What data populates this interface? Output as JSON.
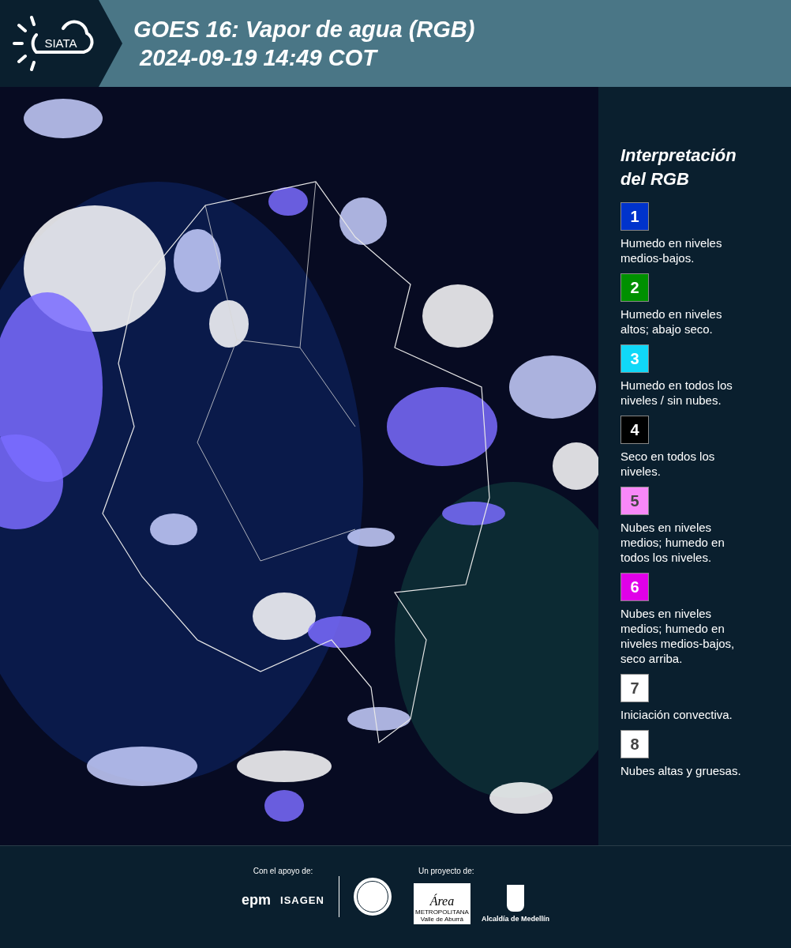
{
  "header": {
    "logo": "SIATA",
    "title_lines": [
      "GOES 16: Vapor de agua (RGB)",
      " 2024-09-19 14:49 COT"
    ]
  },
  "legend": {
    "title_lines": [
      "Interpretación",
      "del RGB"
    ],
    "items": [
      {
        "number": "1",
        "color": "#0033cc",
        "text": "Humedo en niveles medios-bajos."
      },
      {
        "number": "2",
        "color": "#009000",
        "text": "Humedo en niveles altos; abajo seco."
      },
      {
        "number": "3",
        "color": "#10d8f8",
        "text": "Humedo en todos los niveles / sin nubes."
      },
      {
        "number": "4",
        "color": "#000000",
        "text": "Seco en todos los niveles."
      },
      {
        "number": "5",
        "color": "#f888f8",
        "text": "Nubes en niveles medios; humedo en todos los niveles."
      },
      {
        "number": "6",
        "color": "#e000e8",
        "text": "Nubes en niveles medios; humedo en niveles medios-bajos, seco arriba."
      },
      {
        "number": "7",
        "color": "#ffffff",
        "text": "Iniciación convectiva."
      },
      {
        "number": "8",
        "color": "#ffffff",
        "text": "Nubes altas y gruesas."
      }
    ]
  },
  "footer": {
    "support_label": "Con el apoyo de:",
    "support_logos": [
      "epm",
      "ISAGEN"
    ],
    "project_label": "Un proyecto de:",
    "area_logo": {
      "mark": "Área",
      "line1": "METROPOLITANA",
      "line2": "Valle de Aburrá"
    },
    "alcaldia": "Alcaldía de Medellín"
  }
}
